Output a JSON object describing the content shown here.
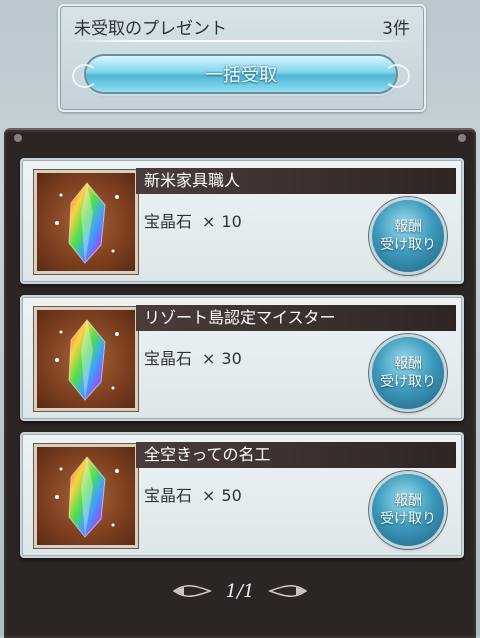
{
  "header": {
    "title": "未受取のプレゼント",
    "count": "3件",
    "bulk_button_label": "一括受取"
  },
  "gifts": [
    {
      "name": "新米家具職人",
      "item": "宝晶石",
      "times": "×",
      "quantity": "10",
      "claim_line1": "報酬",
      "claim_line2": "受け取り",
      "icon": "rainbow-crystal-icon"
    },
    {
      "name": "リゾート島認定マイスター",
      "item": "宝晶石",
      "times": "×",
      "quantity": "30",
      "claim_line1": "報酬",
      "claim_line2": "受け取り",
      "icon": "rainbow-crystal-icon"
    },
    {
      "name": "全空きっての名工",
      "item": "宝晶石",
      "times": "×",
      "quantity": "50",
      "claim_line1": "報酬",
      "claim_line2": "受け取り",
      "icon": "rainbow-crystal-icon"
    }
  ],
  "pagination": {
    "label": "1/1"
  },
  "colors": {
    "accent_button": "#4fb6d6",
    "panel_bg": "#2b2523",
    "name_bar": "#3a2e2c"
  }
}
